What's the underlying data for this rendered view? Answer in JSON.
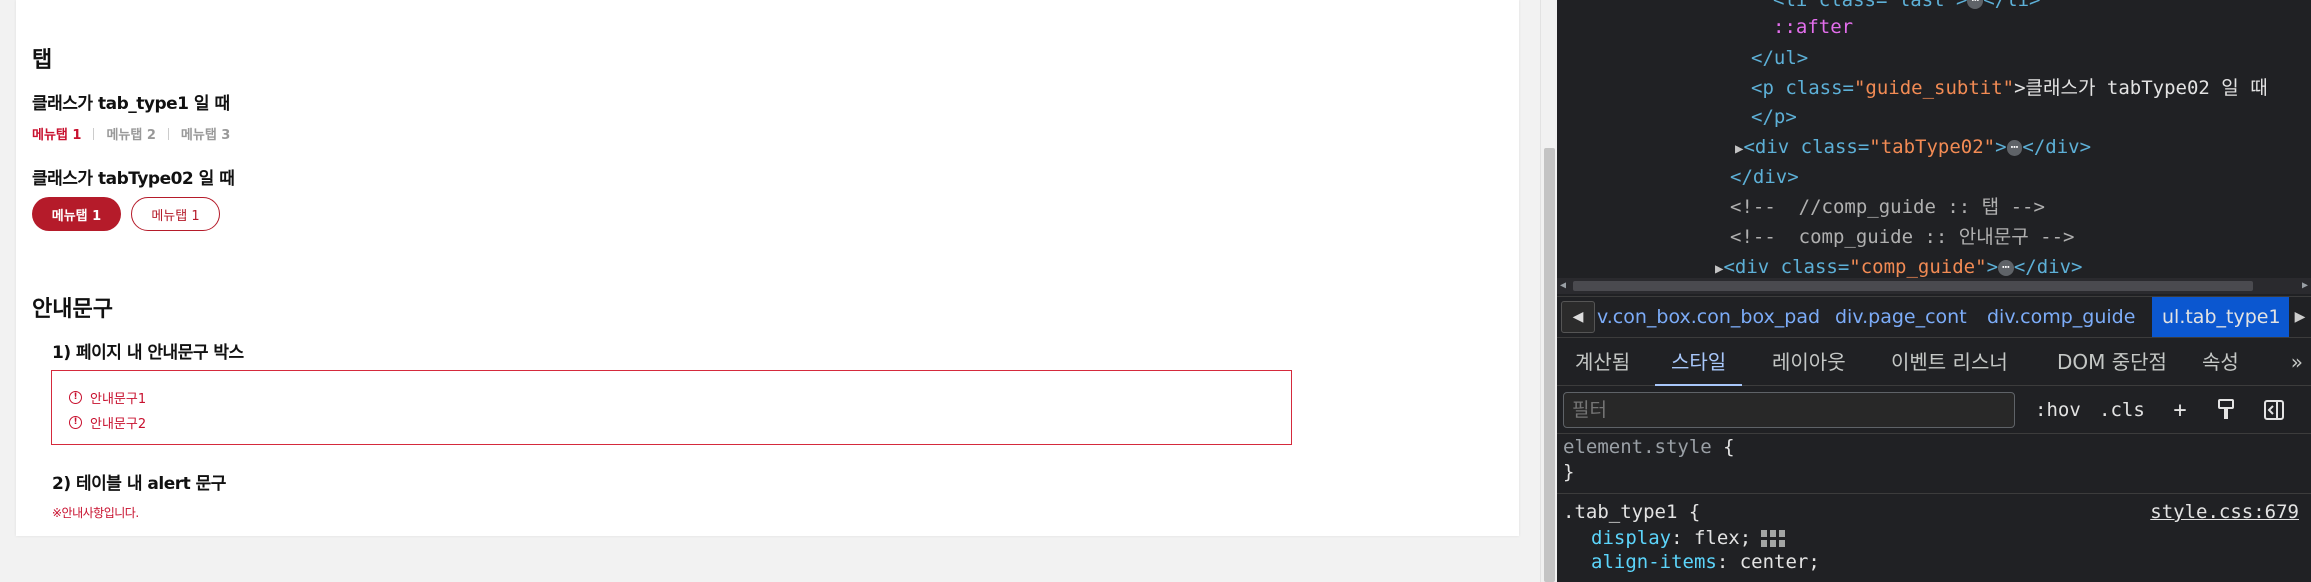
{
  "page": {
    "tab_section_title": "탭",
    "tab1_subtitle": "클래스가 tab_type1 일 때",
    "tab1_items": [
      "메뉴탭 1",
      "메뉴탭 2",
      "메뉴탭 3"
    ],
    "tab2_subtitle": "클래스가 tabType02 일 때",
    "tab2_items": [
      "메뉴탭 1",
      "메뉴탭 1"
    ],
    "notice_section_title": "안내문구",
    "notice_sub1": "1) 페이지 내 안내문구 박스",
    "notice_items": [
      "안내문구1",
      "안내문구2"
    ],
    "notice_icon": "!",
    "notice_sub2": "2) 테이블 내 alert 문구",
    "alert_text": "※안내사항입니다.",
    "accent_color": "#c8102e"
  },
  "devtools": {
    "dom_lines": {
      "l0_tag": "<li class=\"last\">",
      "l0_end": "</li>",
      "l1": "::after",
      "l2": "</ul>",
      "l3_open": "<p class=",
      "l3_val": "\"guide_subtit\"",
      "l3_text": ">클래스가 tabType02 일 때",
      "l4": "</p>",
      "l5_open": "<div class=",
      "l5_val": "\"tabType02\"",
      "l5_close": "</div>",
      "l6": "</div>",
      "l7": "<!--  //comp_guide :: 탭 -->",
      "l8": "<!--  comp_guide :: 안내문구 -->",
      "l9_open": "<div class=",
      "l9_val": "\"comp_guide\"",
      "l9_close": "</div>",
      "ellipsis": "⋯"
    },
    "breadcrumbs": [
      "v.con_box.con_box_pad",
      "div.page_cont",
      "div.comp_guide",
      "ul.tab_type1"
    ],
    "tabs": [
      "계산됨",
      "스타일",
      "레이아웃",
      "이벤트 리스너",
      "DOM 중단점",
      "속성"
    ],
    "active_tab": "스타일",
    "more_tabs": "»",
    "filter_placeholder": "필터",
    "hov_label": ":hov",
    "cls_label": ".cls",
    "styles": {
      "element_style": "element.style",
      "open_brace": " {",
      "close_brace": "}",
      "rule_selector": ".tab_type1",
      "rule_source": "style.css:679",
      "decl1_prop": "display",
      "decl1_val": "flex;",
      "decl2_prop": "align-items",
      "decl2_val": "center;"
    }
  }
}
